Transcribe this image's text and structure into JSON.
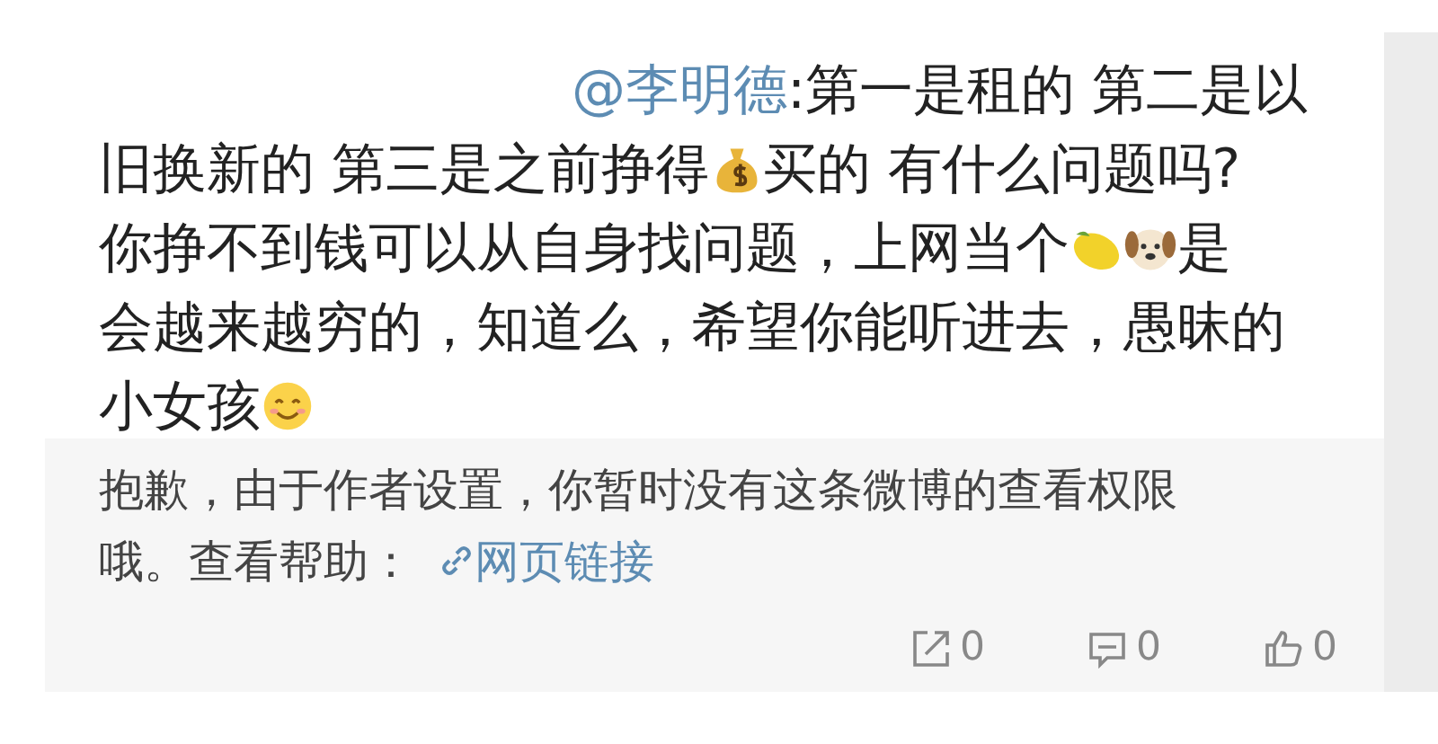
{
  "comment": {
    "lines": [
      [
        {
          "kind": "mention",
          "text": "@李明德"
        },
        {
          "kind": "text",
          "text": ":第一是租的 第二是以"
        }
      ],
      [
        {
          "kind": "text",
          "text": "旧换新的 第三是之前挣得"
        },
        {
          "kind": "moneybag"
        },
        {
          "kind": "text",
          "text": "买的 有什么问题吗?"
        }
      ],
      [
        {
          "kind": "text",
          "text": "你挣不到钱可以从自身找问题，上网当个"
        },
        {
          "kind": "lemon"
        },
        {
          "kind": "dog"
        },
        {
          "kind": "text",
          "text": "是"
        }
      ],
      [
        {
          "kind": "text",
          "text": "会越来越穷的，知道么，希望你能听进去，愚昧的"
        }
      ],
      [
        {
          "kind": "text",
          "text": "小女孩"
        },
        {
          "kind": "smile"
        }
      ]
    ]
  },
  "notice": {
    "lines": [
      "抱歉，由于作者设置，你暂时没有这条微博的查看权限",
      "哦。查看帮助："
    ],
    "link": "网页链接"
  },
  "actions": [
    {
      "kind": "share",
      "count": "0"
    },
    {
      "kind": "comment",
      "count": "0"
    },
    {
      "kind": "like",
      "count": "0"
    }
  ]
}
